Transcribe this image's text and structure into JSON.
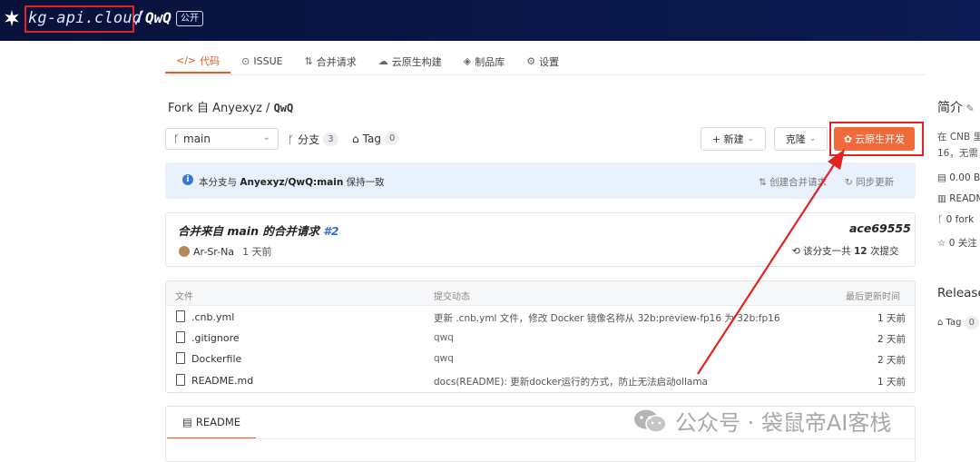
{
  "header": {
    "org": "kg-api.cloud",
    "separator": "/",
    "repo": "QwQ",
    "visibility": "公开"
  },
  "tabs": [
    {
      "icon": "</>",
      "label": "代码",
      "active": true
    },
    {
      "icon": "⊙",
      "label": "ISSUE"
    },
    {
      "icon": "⇅",
      "label": "合并请求"
    },
    {
      "icon": "☁",
      "label": "云原生构建"
    },
    {
      "icon": "◈",
      "label": "制品库"
    },
    {
      "icon": "⚙",
      "label": "设置"
    }
  ],
  "fork": {
    "prefix": "Fork 自 Anyexyz / ",
    "repo": "QwQ"
  },
  "branch": {
    "selected": "main",
    "branches_label": "分支",
    "branches_count": "3",
    "tag_label": "Tag",
    "tag_count": "0"
  },
  "actions": {
    "new": "+ 新建",
    "clone": "克隆",
    "dev": "云原生开发"
  },
  "sync": {
    "prefix": "本分支与 ",
    "ref": "Anyexyz/QwQ:main",
    "suffix": " 保持一致",
    "create_pr": "创建合并请求",
    "update": "同步更新"
  },
  "commit": {
    "title": "合并来自 main 的合并请求 ",
    "number": "#2",
    "hash": "ace69555",
    "author": "Ar-Sr-Na",
    "time": "1 天前",
    "count_prefix": "该分支一共 ",
    "count": "12",
    "count_suffix": " 次提交"
  },
  "table": {
    "headers": {
      "file": "文件",
      "commit": "提交动态",
      "updated": "最后更新时间"
    },
    "rows": [
      {
        "name": ".cnb.yml",
        "message": "更新 .cnb.yml 文件，修改 Docker 镜像名称从 32b:preview-fp16 为 32b:fp16",
        "time": "1 天前"
      },
      {
        "name": ".gitignore",
        "message": "qwq",
        "time": "2 天前"
      },
      {
        "name": "Dockerfile",
        "message": "qwq",
        "time": "2 天前"
      },
      {
        "name": "README.md",
        "message": "docs(README): 更新docker运行的方式，防止无法启动ollama",
        "time": "1 天前"
      }
    ]
  },
  "readme": {
    "label": "README"
  },
  "sidebar": {
    "intro": "简介",
    "desc1": "在 CNB 里",
    "desc2": "16，无需",
    "size": "0.00 B",
    "readme": "READM",
    "forks": "0 fork",
    "watch": "0 关注",
    "releases": "Release",
    "tag": "Tag",
    "tag_count": "0"
  },
  "watermark": "公众号 · 袋鼠帝AI客栈",
  "colors": {
    "accent": "#ed5b25",
    "header_bg": "#0b1a52",
    "annotation": "#e52222",
    "link": "#3a6ed8"
  }
}
